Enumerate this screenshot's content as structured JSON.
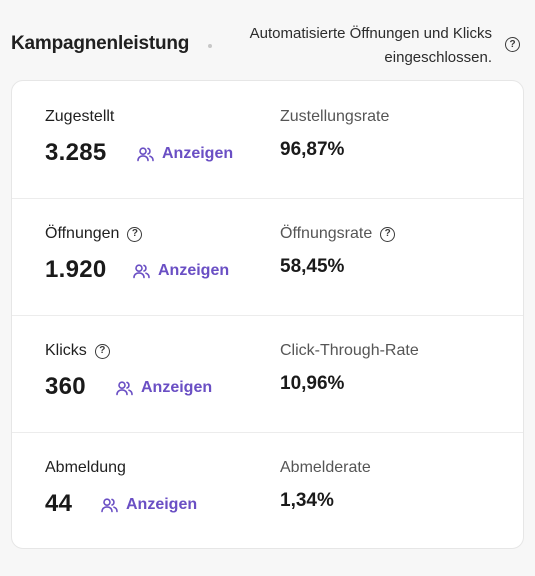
{
  "header": {
    "title": "Kampagnenleistung",
    "note": "Automatisierte Öffnungen und Klicks eingeschlossen."
  },
  "icons": {
    "help": "question-circle-icon",
    "people": "users-icon"
  },
  "colors": {
    "accent": "#6a4fc4",
    "background": "#f7f7f7",
    "card": "#ffffff"
  },
  "metrics": [
    {
      "label": "Zugestellt",
      "value": "3.285",
      "link": "Anzeigen",
      "rate_label": "Zustellungsrate",
      "rate_value": "96,87%"
    },
    {
      "label": "Öffnungen",
      "value": "1.920",
      "link": "Anzeigen",
      "rate_label": "Öffnungsrate",
      "rate_value": "58,45%"
    },
    {
      "label": "Klicks",
      "value": "360",
      "link": "Anzeigen",
      "rate_label": "Click-Through-Rate",
      "rate_value": "10,96%"
    },
    {
      "label": "Abmeldung",
      "value": "44",
      "link": "Anzeigen",
      "rate_label": "Abmelderate",
      "rate_value": "1,34%"
    }
  ]
}
